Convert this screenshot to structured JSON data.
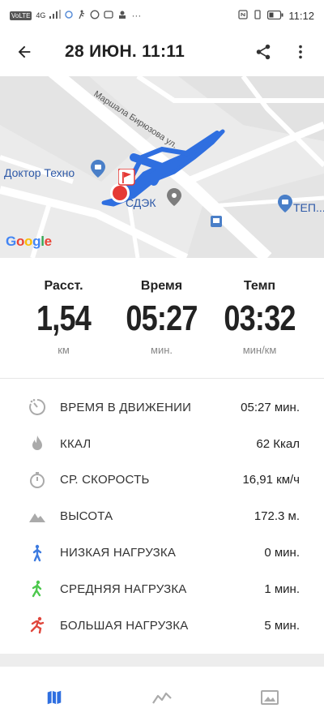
{
  "status_bar": {
    "network": "VoLTE",
    "signal_label": "4G",
    "time": "11:12"
  },
  "header": {
    "title": "28 ИЮН. 11:11",
    "back_icon": "arrow-left-icon",
    "share_icon": "share-icon",
    "more_icon": "more-vert-icon"
  },
  "map": {
    "street_name": "Маршала Бирюзова ул.",
    "places": [
      "Доктор Техно",
      "СДЭК",
      "ТЕП..."
    ],
    "google_logo": [
      "G",
      "o",
      "o",
      "g",
      "l",
      "e"
    ],
    "colors": {
      "route": "#2f6fe0",
      "marker": "#e53935",
      "place_pin": "#4a7fc8"
    }
  },
  "stats": [
    {
      "label": "Расст.",
      "value": "1,54",
      "unit": "км"
    },
    {
      "label": "Время",
      "value": "05:27",
      "unit": "мин."
    },
    {
      "label": "Темп",
      "value": "03:32",
      "unit": "мин/км"
    }
  ],
  "metrics": [
    {
      "icon": "timer-motion-icon",
      "label": "ВРЕМЯ В ДВИЖЕНИИ",
      "value": "05:27 мин."
    },
    {
      "icon": "flame-icon",
      "label": "ККАЛ",
      "value": "62 Ккал"
    },
    {
      "icon": "stopwatch-icon",
      "label": "СР. СКОРОСТЬ",
      "value": "16,91 км/ч"
    },
    {
      "icon": "mountain-icon",
      "label": "ВЫСОТА",
      "value": "172.3 м."
    },
    {
      "icon": "walker-blue-icon",
      "label": "НИЗКАЯ НАГРУЗКА",
      "value": "0 мин."
    },
    {
      "icon": "walker-green-icon",
      "label": "СРЕДНЯЯ НАГРУЗКА",
      "value": "1 мин."
    },
    {
      "icon": "runner-red-icon",
      "label": "БОЛЬШАЯ НАГРУЗКА",
      "value": "5 мин."
    }
  ],
  "bottom_nav": [
    {
      "icon": "map-icon",
      "active": true
    },
    {
      "icon": "chart-line-icon",
      "active": false
    },
    {
      "icon": "image-icon",
      "active": false
    }
  ],
  "colors": {
    "accent": "#2f6fe0",
    "low": "#3d7be0",
    "mid": "#4cc84c",
    "high": "#e0473d"
  }
}
